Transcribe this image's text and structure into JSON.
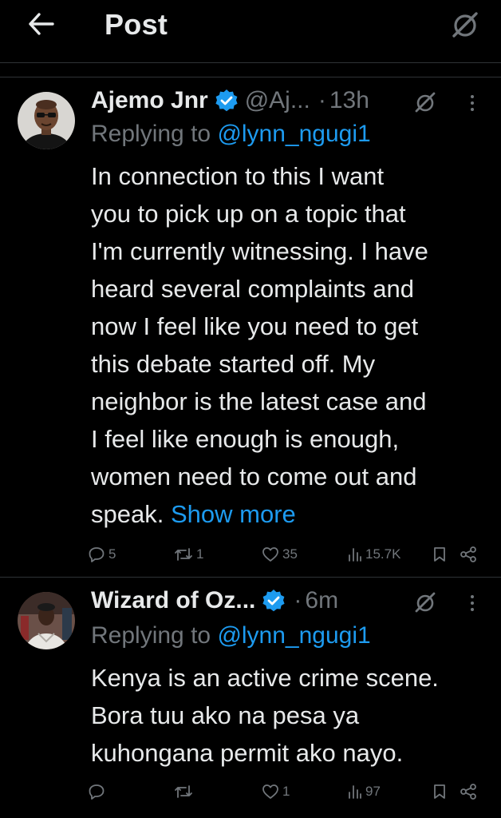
{
  "header": {
    "title": "Post",
    "back_icon": "arrow-left-icon",
    "grok_icon": "grok-icon"
  },
  "colors": {
    "background": "#000000",
    "text": "#e7e9ea",
    "muted": "#71767b",
    "link": "#1d9bf0",
    "divider": "#2f3336"
  },
  "posts": [
    {
      "name": "Ajemo Jnr",
      "handle": "@Aj...",
      "dot": "·",
      "time": "13h",
      "verified": true,
      "replying_prefix": "Replying to",
      "replying_to": "@lynn_ngugi1",
      "body_lines": [
        "In connection to this I want",
        "you to pick up on a topic that",
        "I'm currently witnessing. I have",
        "heard several complaints and",
        "now I feel like you need to get",
        "this debate started off. My",
        "neighbor is the latest case and",
        "I feel like enough is enough,",
        "women need to come out and",
        "speak."
      ],
      "show_more": "Show more",
      "stats": {
        "replies": "5",
        "reposts": "1",
        "likes": "35",
        "views": "15.7K"
      }
    },
    {
      "name": "Wizard of Oz...",
      "handle": "",
      "dot": "·",
      "time": "6m",
      "verified": true,
      "replying_prefix": "Replying to",
      "replying_to": "@lynn_ngugi1",
      "body_lines": [
        "Kenya is an active crime scene.",
        "Bora tuu ako na pesa ya",
        "kuhongana permit ako nayo."
      ],
      "stats": {
        "replies": "",
        "reposts": "",
        "likes": "1",
        "views": "97"
      }
    }
  ]
}
